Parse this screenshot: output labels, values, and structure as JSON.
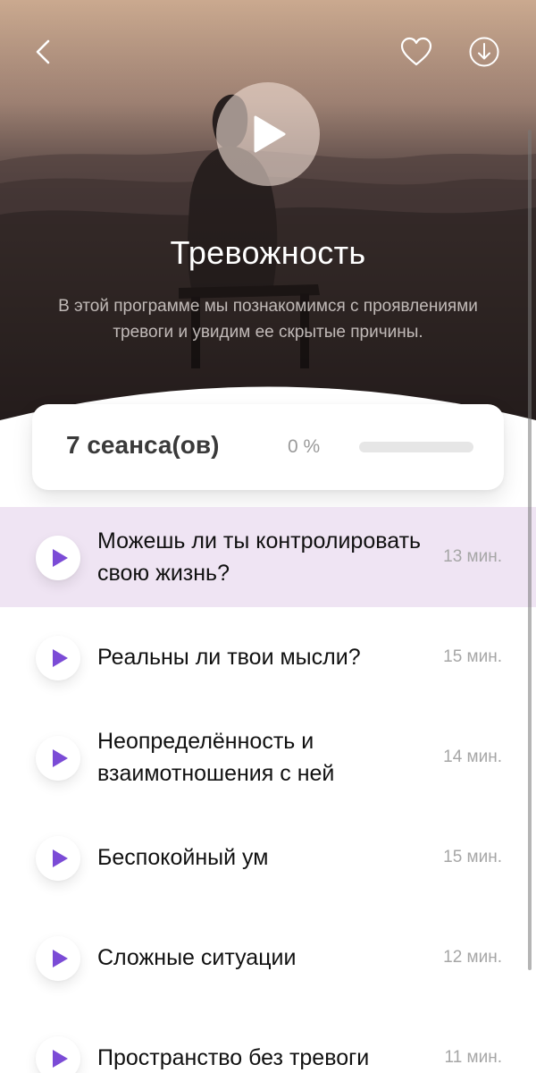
{
  "header": {
    "back_icon": "chevron-left-icon",
    "favorite_icon": "heart-icon",
    "download_icon": "download-circle-icon",
    "play_icon": "play-icon"
  },
  "program": {
    "title": "Тревожность",
    "description": "В этой программе мы познакомимся с проявлениями тревоги и увидим ее скрытые причины."
  },
  "stats": {
    "sessions_label": "7 сеанса(ов)",
    "progress_label": "0 %",
    "progress_fraction": 0
  },
  "sessions": [
    {
      "title": "Можешь ли ты контролировать свою жизнь?",
      "duration": "13 мин.",
      "active": true
    },
    {
      "title": "Реальны ли твои мысли?",
      "duration": "15 мин.",
      "active": false
    },
    {
      "title": "Неопределённость и взаимотношения с ней",
      "duration": "14 мин.",
      "active": false
    },
    {
      "title": "Беспокойный ум",
      "duration": "15 мин.",
      "active": false
    },
    {
      "title": "Сложные ситуации",
      "duration": "12 мин.",
      "active": false
    },
    {
      "title": "Пространство без тревоги",
      "duration": "11 мин.",
      "active": false
    }
  ],
  "colors": {
    "accent": "#7b4bd6",
    "active_row": "#efe4f3",
    "progress_fill": "#8b5cf6"
  }
}
